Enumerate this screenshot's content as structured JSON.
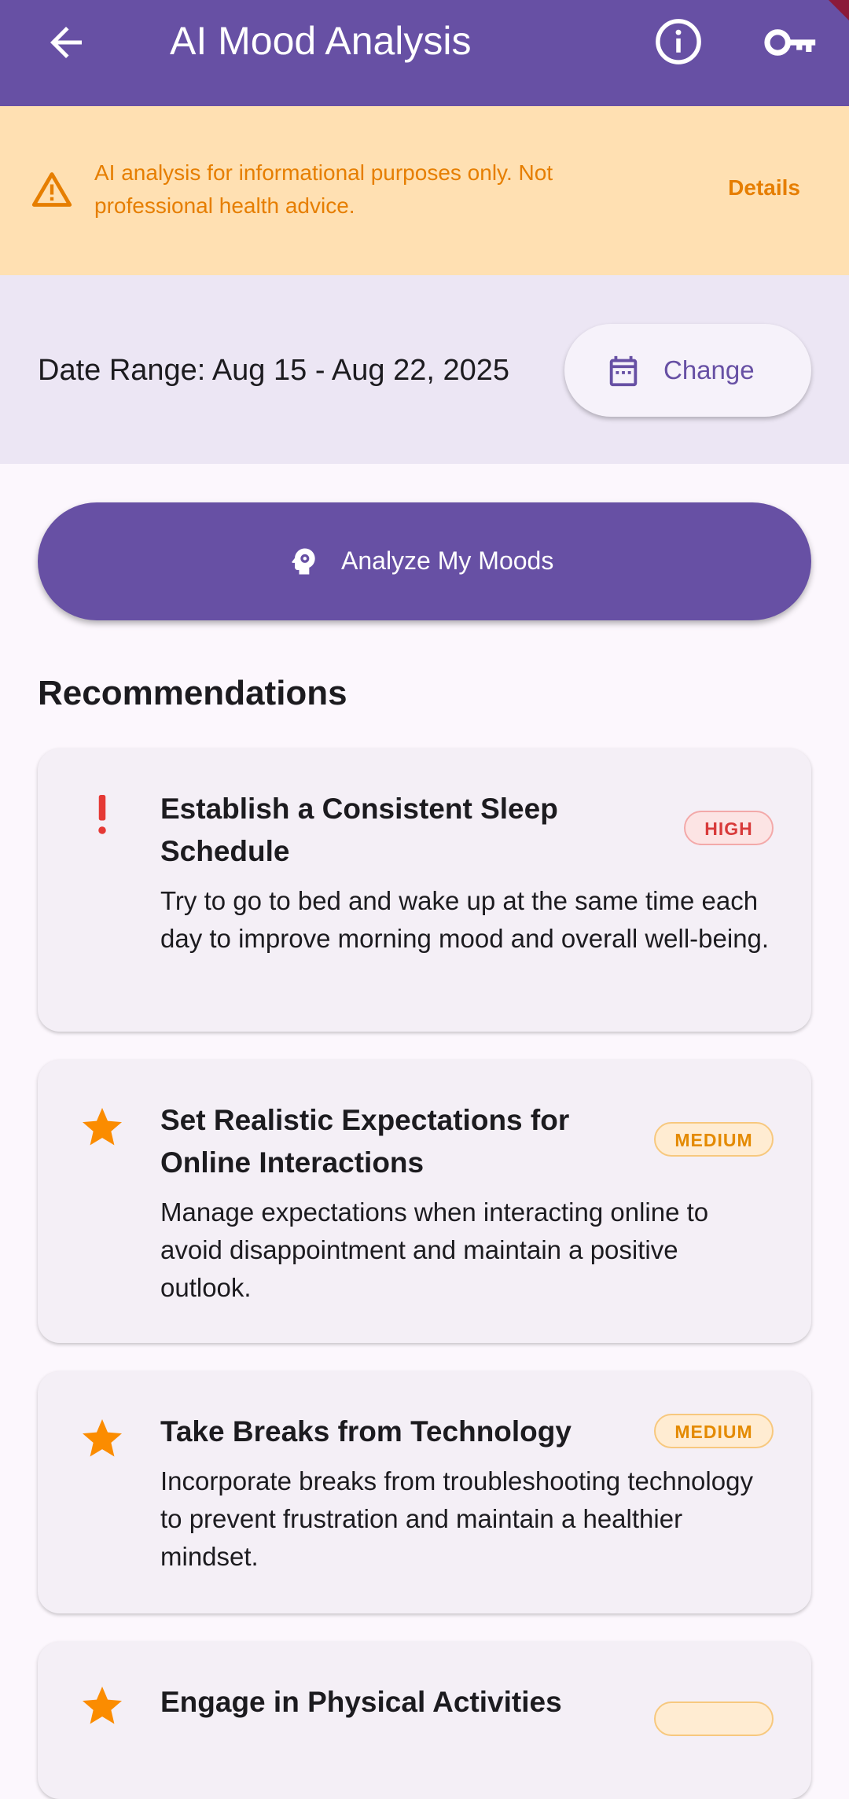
{
  "appbar": {
    "title": "AI Mood Analysis",
    "back_icon": "arrow-back-icon",
    "info_icon": "info-icon",
    "key_icon": "key-icon",
    "color": "#6750a4"
  },
  "disclaimer": {
    "text": "AI analysis for informational purposes only. Not professional health advice.",
    "details_label": "Details",
    "icon": "warning-icon",
    "color": "#e67e00",
    "background": "#ffe0b2"
  },
  "date_range": {
    "label": "Date Range: Aug 15 - Aug 22, 2025",
    "change_label": "Change",
    "icon": "calendar-icon"
  },
  "analyze": {
    "label": "Analyze My Moods",
    "icon": "brain-gear-icon"
  },
  "recommendations": {
    "title": "Recommendations",
    "items": [
      {
        "title_line1": "Establish a Consistent Sleep",
        "title_line2": "Schedule",
        "description": "Try to go to bed and wake up at the same time each day to improve morning mood and overall well-being.",
        "priority": "HIGH",
        "icon": "exclamation-icon"
      },
      {
        "title_line1": "Set Realistic Expectations for",
        "title_line2": "Online Interactions",
        "description": "Manage expectations when interacting online to avoid disappointment and maintain a positive outlook.",
        "priority": "MEDIUM",
        "icon": "star-icon"
      },
      {
        "title_line1": "Take Breaks from Technology",
        "description": "Incorporate breaks from troubleshooting technology to prevent frustration and maintain a healthier mindset.",
        "priority": "MEDIUM",
        "icon": "star-icon"
      },
      {
        "title_line1": "Engage in Physical Activities",
        "icon": "star-icon"
      }
    ]
  }
}
